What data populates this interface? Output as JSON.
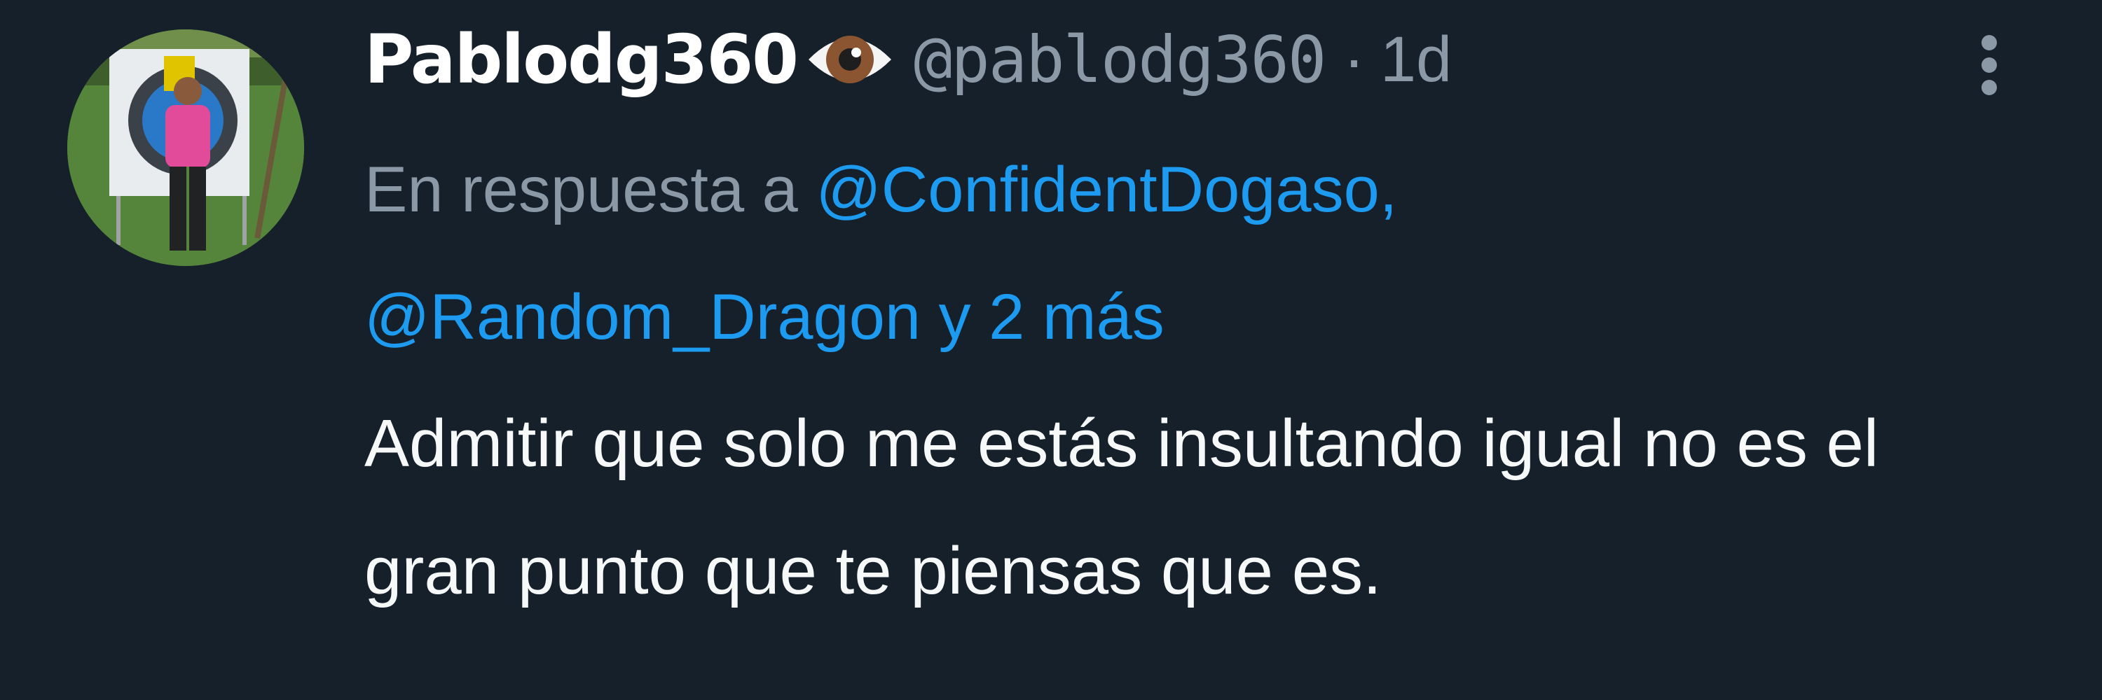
{
  "tweet": {
    "author": {
      "display_name": "Pablodg360",
      "emoji": "eye-emoji",
      "handle": "@pablodg360",
      "separator": "·",
      "time": "1d"
    },
    "reply": {
      "prefix": "En respuesta a",
      "mention_1": "@ConfidentDogaso,",
      "mention_2": "@Random_Dragon",
      "connector": "y",
      "more": "2 más"
    },
    "text": "Admitir que solo me estás insultando igual no es el gran punto que te piensas que es.",
    "more_icon": "vertical-ellipsis-icon"
  },
  "colors": {
    "background": "#15202b",
    "primary_text": "#ffffff",
    "secondary_text": "#8b98a5",
    "link": "#1d9bf0"
  }
}
